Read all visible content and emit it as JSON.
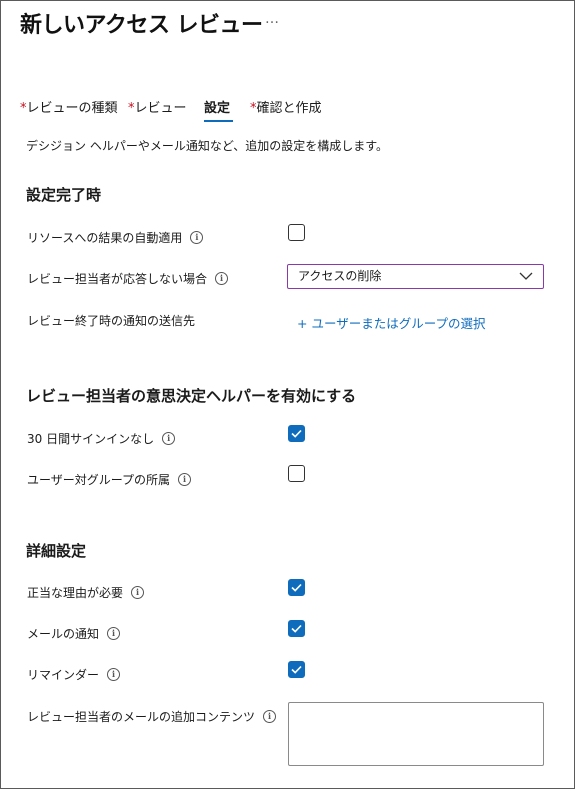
{
  "header": {
    "title": "新しいアクセス レビュー",
    "more": "…"
  },
  "tabs": [
    {
      "required": "*",
      "label": "レビューの種類"
    },
    {
      "required": "*",
      "label": "レビュー"
    },
    {
      "required": "",
      "label": "設定"
    },
    {
      "required": "*",
      "label": "確認と作成"
    }
  ],
  "description": "デシジョン ヘルパーやメール通知など、追加の設定を構成します。",
  "completion": {
    "heading": "設定完了時",
    "auto_apply": {
      "label": "リソースへの結果の自動適用",
      "checked": false
    },
    "no_response": {
      "label": "レビュー担当者が応答しない場合",
      "value": "アクセスの削除"
    },
    "notify": {
      "label": "レビュー終了時の通知の送信先",
      "link": "+ ユーザーまたはグループの選択"
    }
  },
  "helpers": {
    "heading": "レビュー担当者の意思決定ヘルパーを有効にする",
    "no_signin": {
      "label": "30 日間サインインなし",
      "checked": true
    },
    "peer": {
      "label": "ユーザー対グループの所属",
      "checked": false
    }
  },
  "advanced": {
    "heading": "詳細設定",
    "justification": {
      "label": "正当な理由が必要",
      "checked": true
    },
    "email": {
      "label": "メールの通知",
      "checked": true
    },
    "reminders": {
      "label": "リマインダー",
      "checked": true
    },
    "additional_content": {
      "label": "レビュー担当者のメールの追加コンテンツ",
      "value": ""
    }
  },
  "info_glyph": "i",
  "colors": {
    "accent": "#0f6cbd",
    "required": "#c50f1f",
    "select_border": "#8a3aa8"
  }
}
